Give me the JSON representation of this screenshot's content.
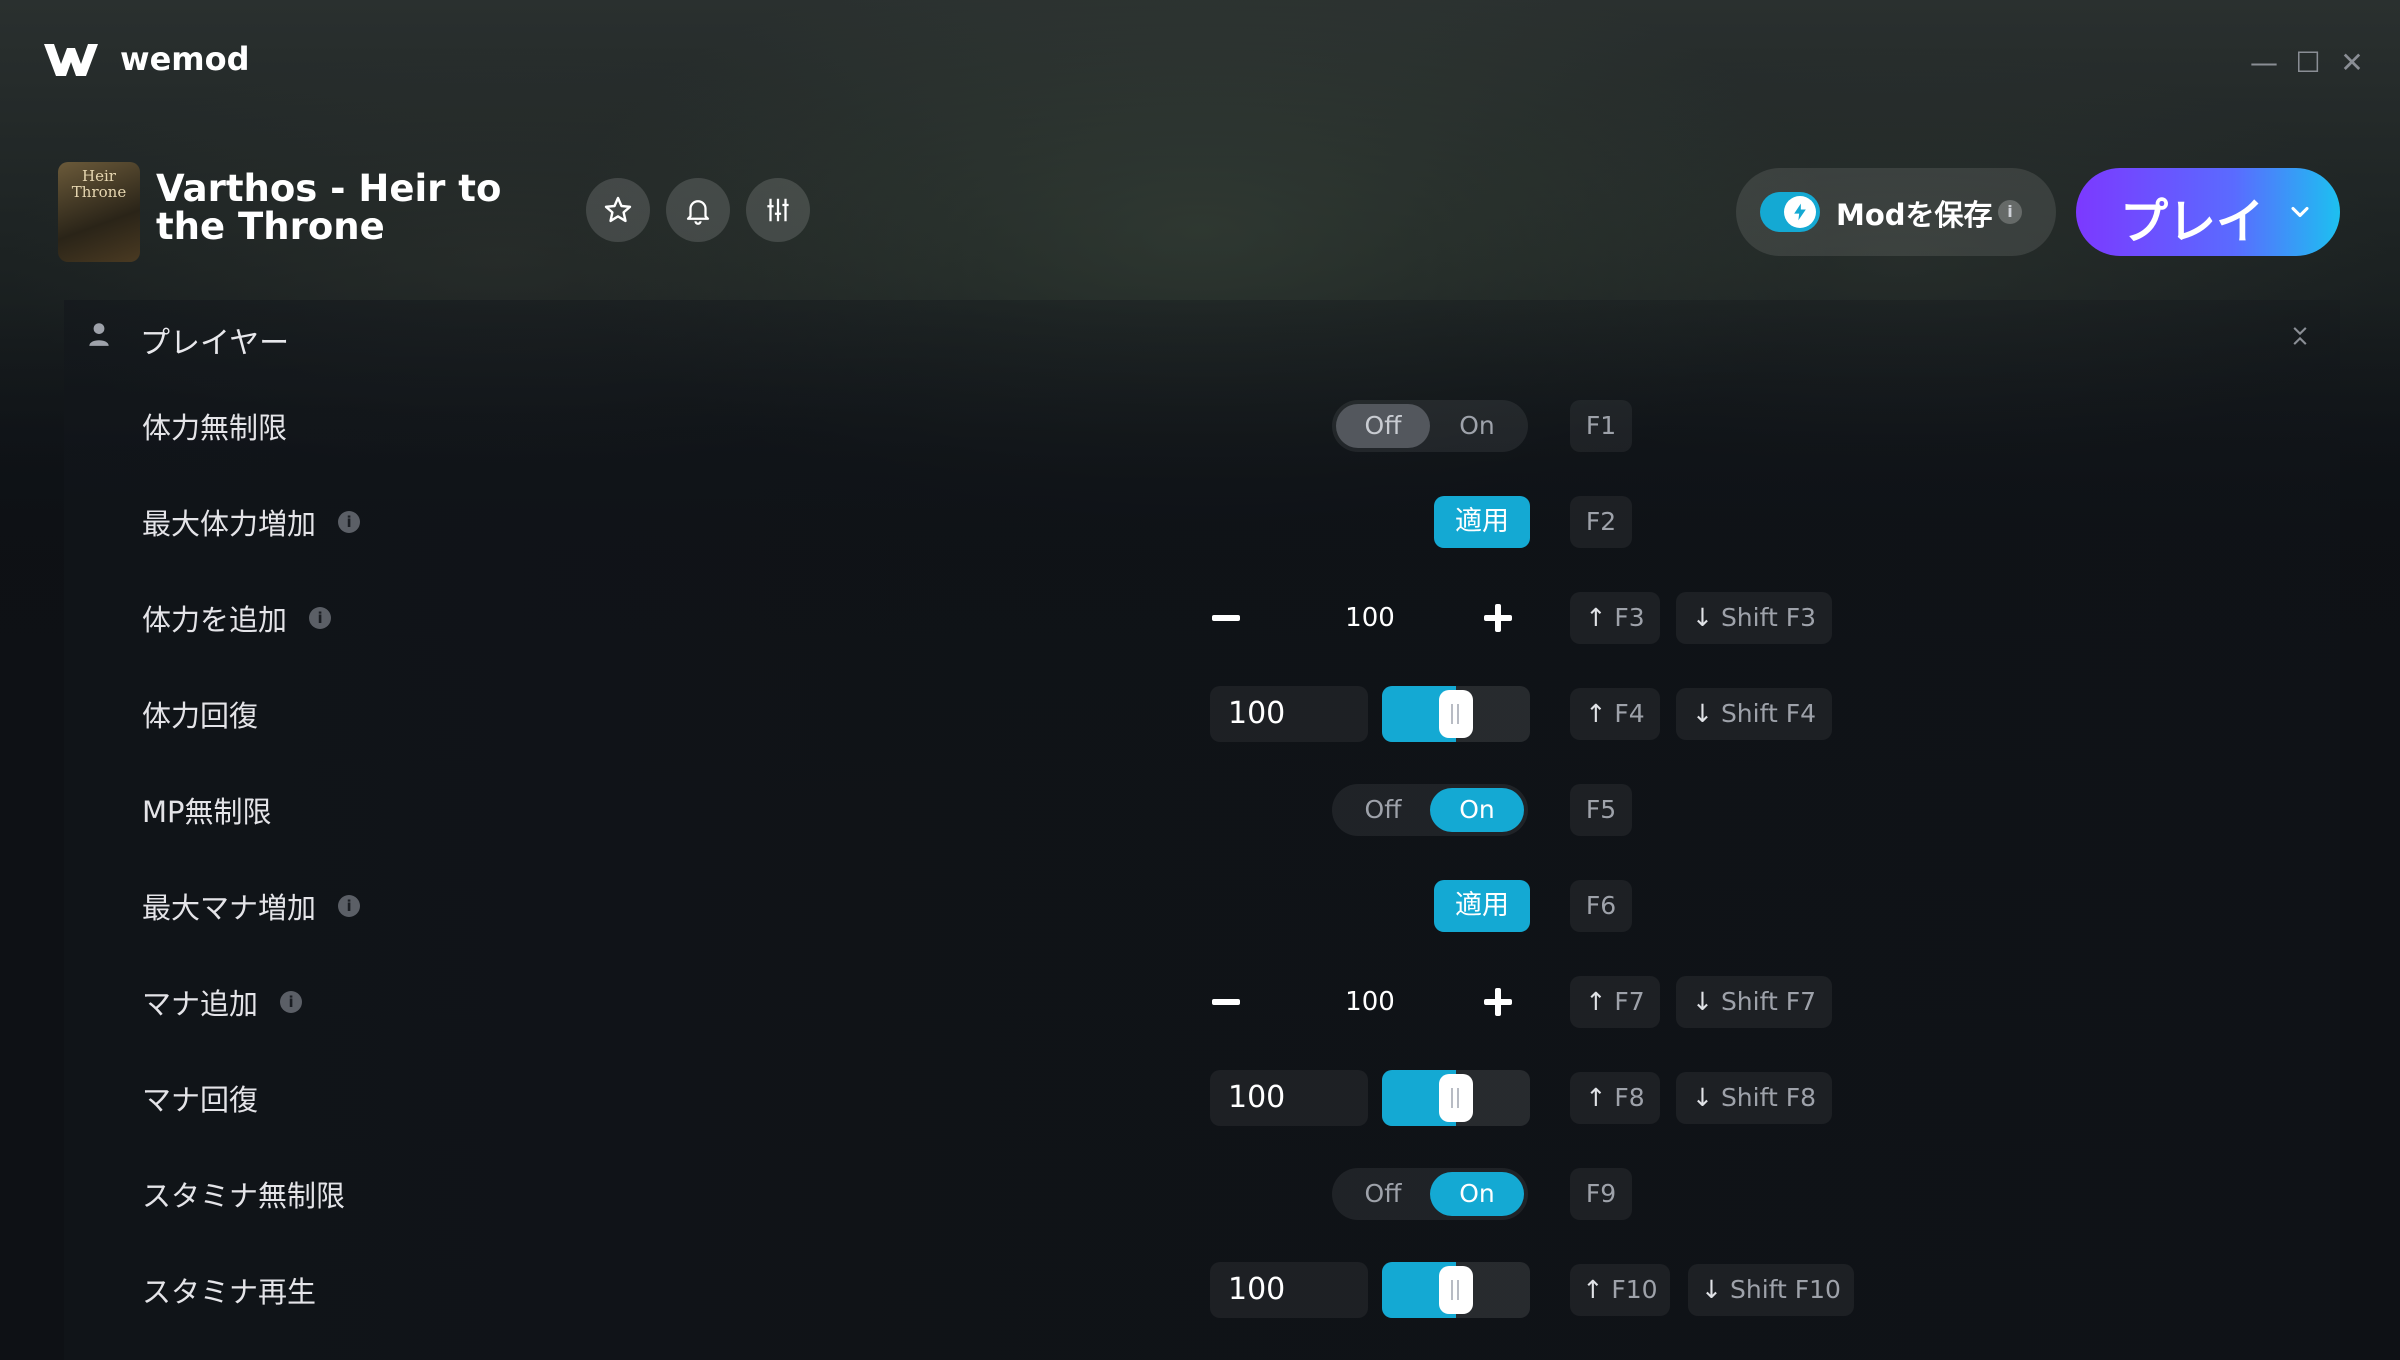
{
  "app": {
    "name": "wemod"
  },
  "window_controls": {
    "minimize": "—",
    "maximize": "☐",
    "close": "✕"
  },
  "header": {
    "cover_text": "Heir\nThrone",
    "game_title": "Varthos - Heir to the Throne",
    "icons": [
      "star-icon",
      "bell-icon",
      "sliders-icon"
    ],
    "save_mods": {
      "label": "Modを保存",
      "info": "i",
      "enabled": true
    },
    "play": {
      "label": "プレイ"
    }
  },
  "section": {
    "title": "プレイヤー"
  },
  "rows": [
    {
      "label": "体力無制限",
      "type": "toggle",
      "off": "Off",
      "on": "On",
      "state": "off",
      "keys": [
        {
          "text": "F1"
        }
      ]
    },
    {
      "label": "最大体力増加",
      "info": "i",
      "type": "apply",
      "button": "適用",
      "keys": [
        {
          "text": "F2"
        }
      ]
    },
    {
      "label": "体力を追加",
      "info": "i",
      "type": "stepper",
      "value": "100",
      "keys": [
        {
          "arrow": "↑",
          "text": "F3"
        },
        {
          "arrow": "↓",
          "text": "Shift F3"
        }
      ]
    },
    {
      "label": "体力回復",
      "type": "slider",
      "value": "100",
      "fill": 0.5,
      "keys": [
        {
          "arrow": "↑",
          "text": "F4"
        },
        {
          "arrow": "↓",
          "text": "Shift F4"
        }
      ]
    },
    {
      "label": "MP無制限",
      "type": "toggle",
      "off": "Off",
      "on": "On",
      "state": "on",
      "keys": [
        {
          "text": "F5"
        }
      ]
    },
    {
      "label": "最大マナ増加",
      "info": "i",
      "type": "apply",
      "button": "適用",
      "keys": [
        {
          "text": "F6"
        }
      ]
    },
    {
      "label": "マナ追加",
      "info": "i",
      "type": "stepper",
      "value": "100",
      "keys": [
        {
          "arrow": "↑",
          "text": "F7"
        },
        {
          "arrow": "↓",
          "text": "Shift F7"
        }
      ]
    },
    {
      "label": "マナ回復",
      "type": "slider",
      "value": "100",
      "fill": 0.5,
      "keys": [
        {
          "arrow": "↑",
          "text": "F8"
        },
        {
          "arrow": "↓",
          "text": "Shift F8"
        }
      ]
    },
    {
      "label": "スタミナ無制限",
      "type": "toggle",
      "off": "Off",
      "on": "On",
      "state": "on",
      "keys": [
        {
          "text": "F9"
        }
      ]
    },
    {
      "label": "スタミナ再生",
      "type": "slider",
      "value": "100",
      "fill": 0.5,
      "keys": [
        {
          "arrow": "↑",
          "text": "F10"
        },
        {
          "arrow": "↓",
          "text": "Shift F10"
        }
      ]
    }
  ],
  "colors": {
    "accent": "#14a9d3",
    "play_start": "#7c39ff",
    "play_end": "#1dc0f0"
  }
}
